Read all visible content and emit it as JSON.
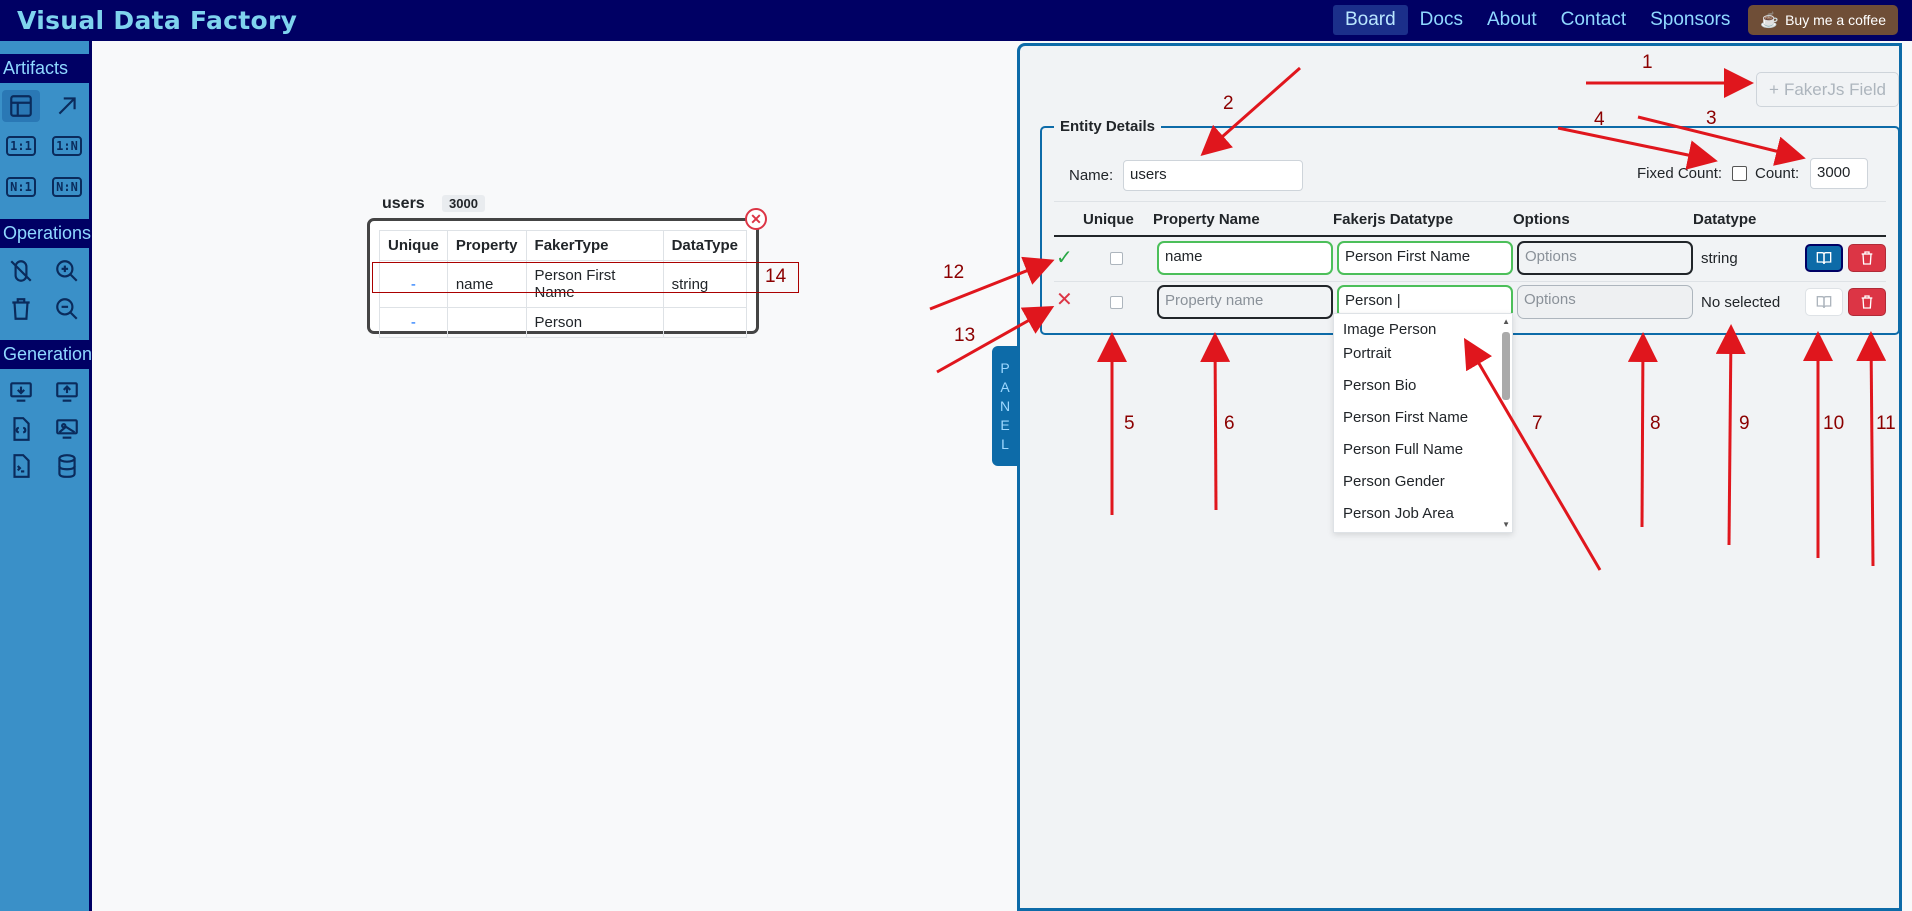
{
  "header": {
    "brand": "Visual Data Factory",
    "nav": [
      "Board",
      "Docs",
      "About",
      "Contact",
      "Sponsors"
    ],
    "active": "Board",
    "coffee_label": "Buy me a coffee"
  },
  "sidebar": {
    "artifacts_label": "Artifacts",
    "operations_label": "Operations",
    "generation_label": "Generation",
    "ratios": [
      "1:1",
      "1:N",
      "N:1",
      "N:N"
    ]
  },
  "entity": {
    "title": "users",
    "count": "3000",
    "headers": [
      "Unique",
      "Property",
      "FakerType",
      "DataType"
    ],
    "rows": [
      {
        "unique": "-",
        "property": "name",
        "faker": "Person First Name",
        "datatype": "string"
      },
      {
        "unique": "-",
        "property": "",
        "faker": "Person",
        "datatype": ""
      }
    ]
  },
  "panel": {
    "tab_letters": [
      "P",
      "A",
      "N",
      "E",
      "L"
    ],
    "faker_button": "FakerJs Field",
    "legend": "Entity Details",
    "name_label": "Name:",
    "name_value": "users",
    "fixed_count_label": "Fixed Count:",
    "count_label": "Count:",
    "count_value": "3000",
    "columns": [
      "Unique",
      "Property Name",
      "Fakerjs Datatype",
      "Options",
      "Datatype"
    ],
    "row1": {
      "property": "name",
      "faker": "Person First Name",
      "options_placeholder": "Options",
      "datatype": "string"
    },
    "row2": {
      "property_placeholder": "Property name",
      "faker": "Person",
      "options_placeholder": "Options",
      "datatype": "No selected"
    },
    "dropdown": [
      "Image Person Portrait",
      "Person Bio",
      "Person First Name",
      "Person Full Name",
      "Person Gender",
      "Person Job Area"
    ]
  },
  "annotations": [
    "1",
    "2",
    "3",
    "4",
    "5",
    "6",
    "7",
    "8",
    "9",
    "10",
    "11",
    "12",
    "13",
    "14"
  ]
}
